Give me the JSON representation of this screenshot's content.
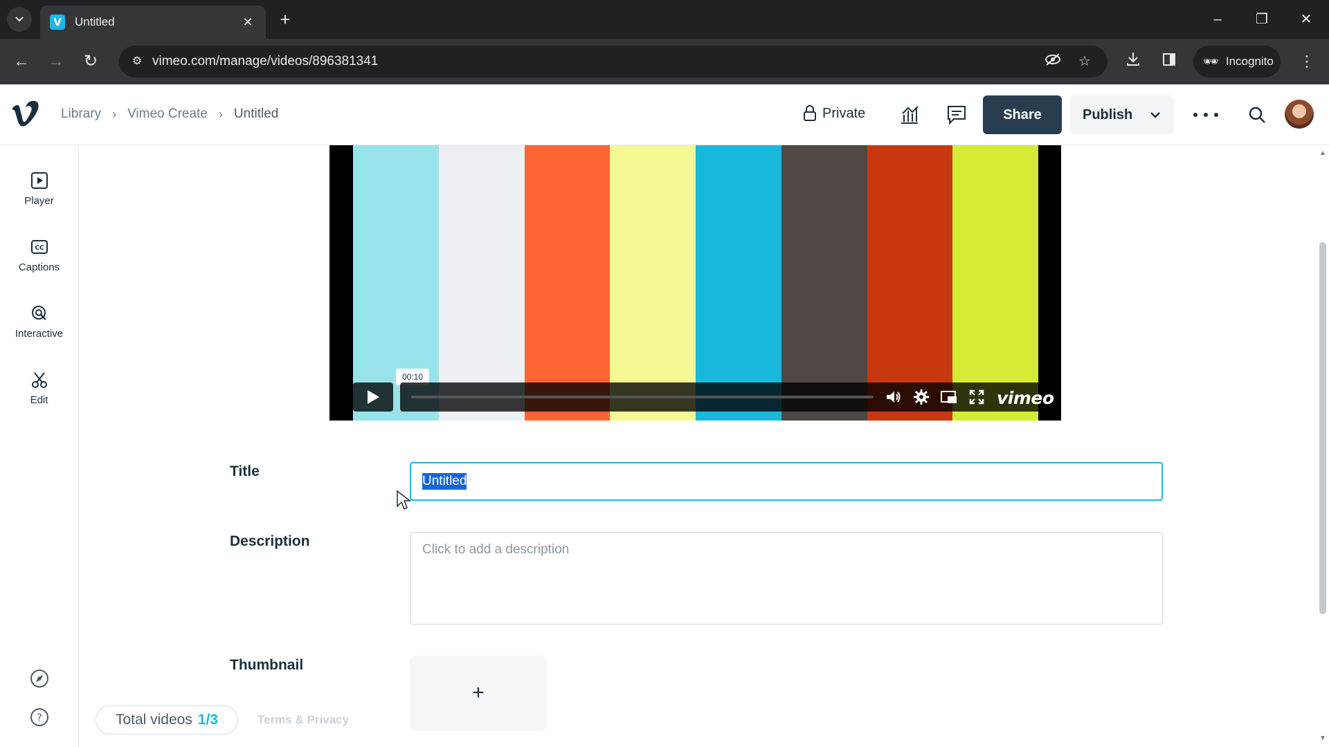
{
  "browser": {
    "tab_title": "Untitled",
    "url": "vimeo.com/manage/videos/896381341",
    "incognito_label": "Incognito"
  },
  "header": {
    "breadcrumb": [
      "Library",
      "Vimeo Create",
      "Untitled"
    ],
    "privacy_label": "Private",
    "share_label": "Share",
    "publish_label": "Publish"
  },
  "sidebar": {
    "items": [
      {
        "label": "Player",
        "icon": "player-icon"
      },
      {
        "label": "Captions",
        "icon": "captions-icon"
      },
      {
        "label": "Interactive",
        "icon": "interactive-icon"
      },
      {
        "label": "Edit",
        "icon": "scissors-icon"
      }
    ],
    "bottom_icons": [
      "compass-icon",
      "help-icon"
    ]
  },
  "video": {
    "time_tooltip": "00:10",
    "brand": "vimeo",
    "bar_colors": [
      "#98e3ea",
      "#eceff3",
      "#fd6434",
      "#f6f993",
      "#18b8da",
      "#4f4845",
      "#c73811",
      "#d5eb35"
    ]
  },
  "form": {
    "title_label": "Title",
    "title_value": "Untitled",
    "description_label": "Description",
    "description_placeholder": "Click to add a description",
    "thumbnail_label": "Thumbnail",
    "thumbnail_add": "+"
  },
  "footer": {
    "total_videos_label": "Total videos",
    "total_videos_count": "1/3",
    "terms_label": "Terms & Privacy"
  },
  "colors": {
    "accent": "#1ab7ea",
    "share_bg": "#283d4f",
    "text": "#1a2e3b"
  }
}
